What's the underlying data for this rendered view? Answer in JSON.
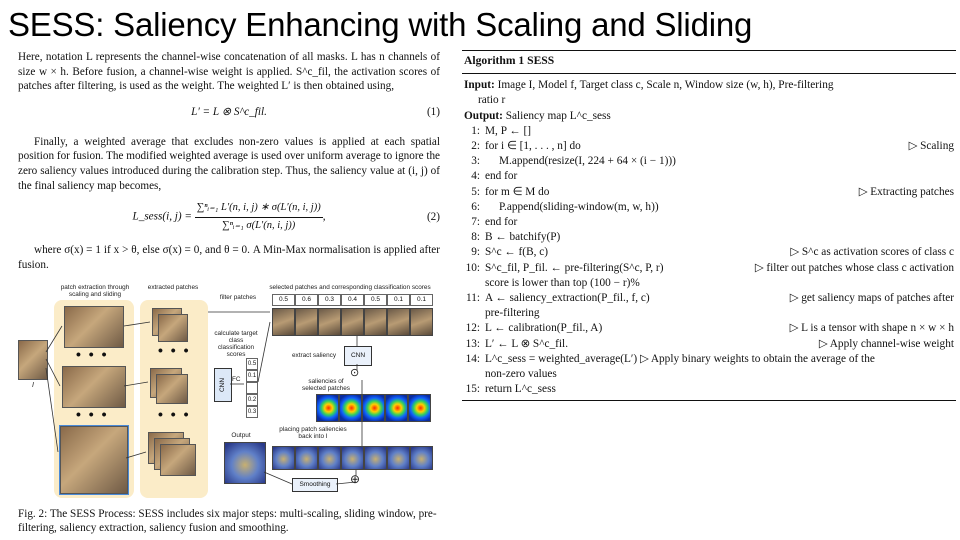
{
  "slide": {
    "title": "SESS: Saliency Enhancing with Scaling and Sliding"
  },
  "left_text": {
    "para1": "Here, notation L represents the channel-wise concatenation of all masks. L has n channels of size w × h. Before fusion, a channel-wise weight is applied. S^c_fil, the activation scores of patches after filtering, is used as the weight. The weighted L′ is then obtained using,",
    "eq1": "L′ = L ⊗ S^c_fil.",
    "eq1_num": "(1)",
    "para2": "Finally, a weighted average that excludes non-zero values is applied at each spatial position for fusion. The modified weighted average is used over uniform average to ignore the zero saliency values introduced during the calibration step. Thus, the saliency value at (i, j) of the final saliency map becomes,",
    "eq2_lhs": "L_sess(i, j) =",
    "eq2_num_text": "∑ⁿᵢ₌₁ L′(n, i, j) ∗ σ(L′(n, i, j))",
    "eq2_den_text": "∑ⁿᵢ₌₁ σ(L′(n, i, j))",
    "eq2_num": "(2)",
    "para3": "where σ(x) = 1 if x > θ, else σ(x) = 0, and θ = 0. A Min-Max normalisation is applied after fusion."
  },
  "figure": {
    "labels": {
      "patch_extraction": "patch extraction through scaling and sliding",
      "extracted_patches": "extracted patches",
      "filter_patches": "filter patches",
      "selected_patches": "selected patches and corresponding classification scores",
      "calc_scores": "calculate target class classification scores",
      "extract_saliency": "extract saliency",
      "cnn": "CNN",
      "saliencies_of_selected": "saliencies of selected patches",
      "placing_patch": "placing patch saliencies back into I",
      "output": "Output",
      "smoothing": "Smoothing",
      "input_label": "I",
      "cnn_small": "CNN",
      "fc": "FC",
      "dots": "• • •",
      "odot": "⊙",
      "oplus": "⊕"
    },
    "scores": [
      "0.5",
      "0.6",
      "0.3",
      "0.4",
      "0.5",
      "0.1",
      "0.1"
    ],
    "vector_scores": [
      "0.5",
      "0.1",
      "",
      "0.2",
      "0.3"
    ],
    "caption": "Fig. 2: The SESS Process: SESS includes six major steps: multi-scaling, sliding window, pre-filtering, saliency extraction, saliency fusion and smoothing."
  },
  "algorithm": {
    "title": "Algorithm 1 SESS",
    "input_label": "Input:",
    "input_text": "Image I, Model f, Target class c, Scale n, Window size (w, h), Pre-filtering",
    "input_cont": "ratio r",
    "output_label": "Output:",
    "output_text": "Saliency map L^c_sess",
    "steps": [
      {
        "num": "1:",
        "text": "M, P ← []",
        "comment": ""
      },
      {
        "num": "2:",
        "text": "for i ∈ [1, . . . , n] do",
        "comment": "▷ Scaling"
      },
      {
        "num": "3:",
        "text": "M.append(resize(I, 224 + 64 × (i − 1)))",
        "comment": ""
      },
      {
        "num": "4:",
        "text": "end for",
        "comment": ""
      },
      {
        "num": "5:",
        "text": "for m ∈ M do",
        "comment": "▷ Extracting patches"
      },
      {
        "num": "6:",
        "text": "P.append(sliding-window(m, w, h))",
        "comment": ""
      },
      {
        "num": "7:",
        "text": "end for",
        "comment": ""
      },
      {
        "num": "8:",
        "text": "B ← batchify(P)",
        "comment": ""
      },
      {
        "num": "9:",
        "text": "S^c ← f(B, c)",
        "comment": "▷ S^c as activation scores of class c"
      },
      {
        "num": "10:",
        "text": "S^c_fil, P_fil. ← pre-filtering(S^c, P, r)",
        "comment": "▷ filter out patches whose class c activation"
      },
      {
        "num": "",
        "text": "score is lower than top (100 − r)%",
        "comment": ""
      },
      {
        "num": "11:",
        "text": "A ← saliency_extraction(P_fil., f, c)",
        "comment": "▷ get saliency maps of patches after"
      },
      {
        "num": "",
        "text": "pre-filtering",
        "comment": ""
      },
      {
        "num": "12:",
        "text": "L ← calibration(P_fil., A)",
        "comment": "▷ L is a tensor with shape n × w × h"
      },
      {
        "num": "13:",
        "text": "L′ ← L ⊗ S^c_fil.",
        "comment": "▷ Apply channel-wise weight"
      },
      {
        "num": "14:",
        "text": "L^c_sess = weighted_average(L′) ▷ Apply binary weights to obtain the average of the",
        "comment": ""
      },
      {
        "num": "",
        "text": "non-zero values",
        "comment": ""
      },
      {
        "num": "15:",
        "text": "return L^c_sess",
        "comment": ""
      }
    ]
  },
  "colors": {
    "panel_bg": "#fbecc8",
    "text": "#111111",
    "background": "#ffffff"
  }
}
